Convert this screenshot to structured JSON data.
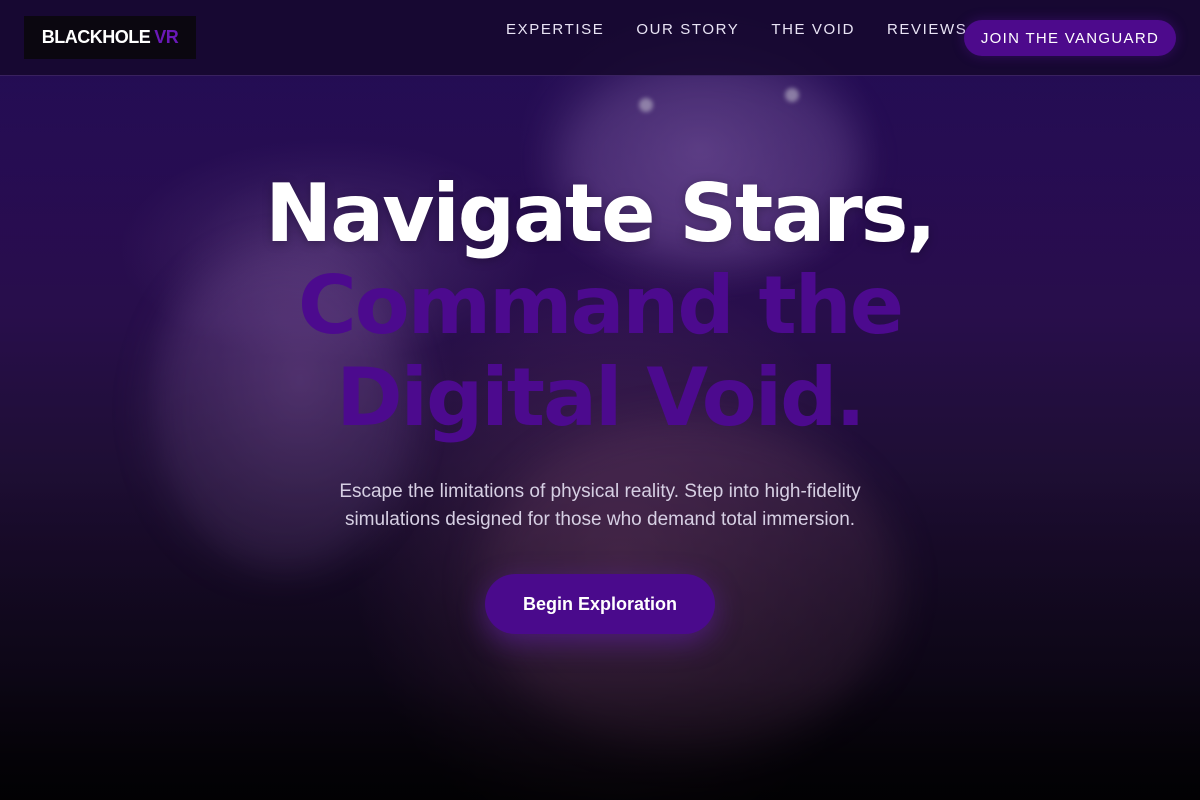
{
  "brand": {
    "name_white": "BLACKHOLE",
    "name_accent": "VR"
  },
  "nav": {
    "links": [
      "EXPERTISE",
      "OUR STORY",
      "THE VOID",
      "REVIEWS"
    ],
    "cta": "JOIN THE VANGUARD"
  },
  "hero": {
    "title_line1": "Navigate Stars,",
    "title_line2": "Command the",
    "title_line3": "Digital Void.",
    "subtitle": "Escape the limitations of physical reality. Step into high-fidelity simulations designed for those who demand total immersion.",
    "cta": "Begin Exploration"
  },
  "colors": {
    "accent": "#4c0a8e",
    "navbar_bg": "#16082d",
    "text_light": "#ffffff",
    "subtitle_text": "#d6cfe3"
  },
  "icons": []
}
